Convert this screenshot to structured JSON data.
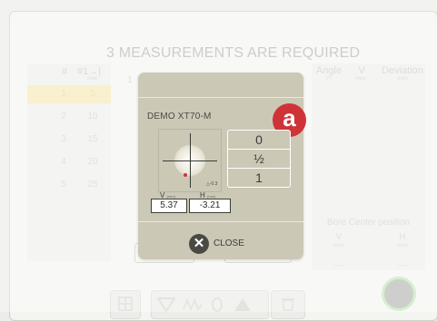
{
  "title": "3 MEASUREMENTS ARE REQUIRED",
  "left_table": {
    "headers": [
      "#",
      "#1→|"
    ],
    "header_units": [
      "",
      "(mm)"
    ],
    "rows": [
      {
        "num": "1",
        "dist": "5"
      },
      {
        "num": "2",
        "dist": "10"
      },
      {
        "num": "3",
        "dist": "15"
      },
      {
        "num": "4",
        "dist": "20"
      },
      {
        "num": "5",
        "dist": "25"
      }
    ],
    "active_row": 0
  },
  "middle_label": "1",
  "right_table": {
    "headers": [
      "Angle",
      "V",
      "Deviation"
    ],
    "header_units": [
      "(°)",
      "(mm)",
      "(mm)"
    ]
  },
  "bore_center": {
    "title": "Bore Center position",
    "cols": [
      "V",
      "H"
    ],
    "units": [
      "(mm)",
      "(mm)"
    ],
    "values": [
      "----",
      "----"
    ]
  },
  "modal": {
    "device_name": "DEMO XT70-M",
    "badge": "a",
    "resolution_options": [
      "0",
      "½",
      "1"
    ],
    "tolerance_label": "△-0.3",
    "v_label": "V",
    "h_label": "H",
    "unit": "(mm)",
    "v_value": "5.37",
    "h_value": "-3.21",
    "close_label": "CLOSE"
  },
  "colors": {
    "modal_bg": "#ccc8b6",
    "badge": "#cf3338",
    "active_row": "#f4e9b4",
    "start_ring": "#bde8b2",
    "laser_dot": "#d63032"
  },
  "icons": {
    "toolbar": [
      "grid-icon",
      "down-arrow-icon",
      "waveform-icon",
      "zero-icon",
      "up-arrow-icon",
      "trash-icon"
    ],
    "close": "close-x-icon"
  }
}
